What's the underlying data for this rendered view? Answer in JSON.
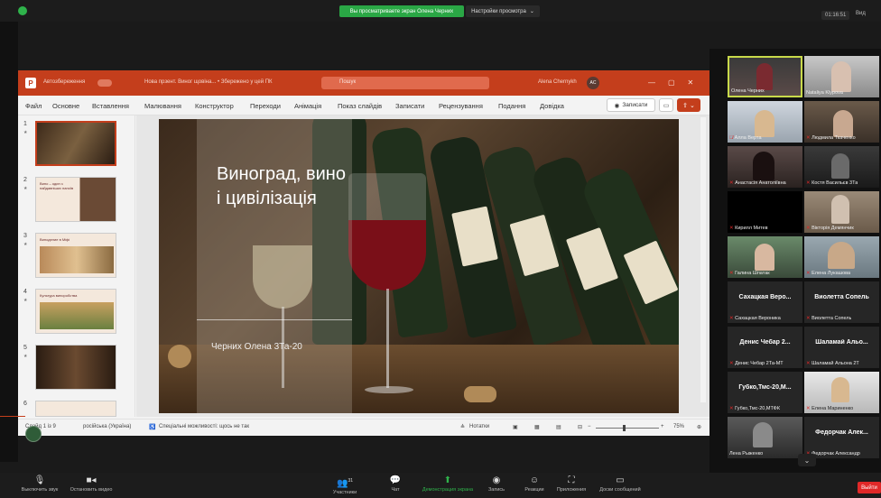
{
  "zoom_top": {
    "share_banner": "Вы просматриваете экран Олена Черних",
    "view_options": "Настройки просмотра",
    "timer": "01:16:51",
    "view": "Вид"
  },
  "ppt": {
    "autosave": "Автозбереження",
    "doc_title": "Нова прзент. Виног щовіна... • Збережено у цей ПК",
    "search_placeholder": "Пошук",
    "account_name": "Alena Chernykh",
    "account_initials": "AC",
    "tabs": [
      "Файл",
      "Основне",
      "Вставлення",
      "Малювання",
      "Конструктор",
      "Переходи",
      "Анімація",
      "Показ слайдів",
      "Записати",
      "Рецензування",
      "Подання",
      "Довідка"
    ],
    "record_label": "Записати",
    "slide_title": "Виноград, вино і цивілізація",
    "slide_author": "Черних Олена 3Та-20",
    "thumbs": [
      {
        "num": "1",
        "caption": ""
      },
      {
        "num": "2",
        "caption": "Вино – один з найдавніших напоїв"
      },
      {
        "num": "3",
        "caption": "Виноделие в Міфі"
      },
      {
        "num": "4",
        "caption": "Культура виноробства"
      },
      {
        "num": "5",
        "caption": ""
      },
      {
        "num": "6",
        "caption": ""
      }
    ],
    "status": {
      "slide_counter": "Слайд 1 із 9",
      "language": "російська (Україна)",
      "accessibility": "Спеціальні можливості: щось не так",
      "notes": "Нотатки",
      "zoom": "75%"
    }
  },
  "gallery": [
    {
      "name": "Олена Черних",
      "big": "",
      "video": true,
      "muted": false
    },
    {
      "name": "Nataliya Klypova",
      "big": "",
      "video": true,
      "muted": false
    },
    {
      "name": "Алла Верта",
      "big": "",
      "video": true,
      "muted": true
    },
    {
      "name": "Людмила Ткаченко",
      "big": "",
      "video": true,
      "muted": true
    },
    {
      "name": "Анастасія Анатоліївна",
      "big": "",
      "video": true,
      "muted": true
    },
    {
      "name": "Костя Васильєв 3Та",
      "big": "",
      "video": true,
      "muted": true
    },
    {
      "name": "Кирилл Митев",
      "big": "",
      "video": true,
      "muted": true
    },
    {
      "name": "Вікторія Демянчик",
      "big": "",
      "video": true,
      "muted": true
    },
    {
      "name": "Галина Шпатак",
      "big": "",
      "video": true,
      "muted": true
    },
    {
      "name": "Елена Лукашова",
      "big": "",
      "video": true,
      "muted": true
    },
    {
      "name": "Сахацкая Вероника",
      "big": "Сахацкая Веро...",
      "video": false,
      "muted": true
    },
    {
      "name": "Виолетта Сопель",
      "big": "Виолетта Сопель",
      "video": false,
      "muted": true
    },
    {
      "name": "Денис Чебар 2Та-МТ",
      "big": "Денис Чебар 2...",
      "video": false,
      "muted": true
    },
    {
      "name": "Шаламай Альона 2Т",
      "big": "Шаламай Альо...",
      "video": false,
      "muted": true
    },
    {
      "name": "Губко,Тмс-20,МТФК",
      "big": "Губко,Тмс-20,М...",
      "video": false,
      "muted": true
    },
    {
      "name": "Елена Мариненко",
      "big": "",
      "video": true,
      "muted": true
    },
    {
      "name": "Лена Рыженко",
      "big": "",
      "video": true,
      "muted": false
    },
    {
      "name": "Федорчак Александр",
      "big": "Федорчак Алек...",
      "video": false,
      "muted": true
    }
  ],
  "toolbar": {
    "mute": "Выключить звук",
    "video": "Остановить видео",
    "participants": "Участники",
    "participants_count": "31",
    "chat": "Чат",
    "share": "Демонстрация экрана",
    "record": "Запись",
    "reactions": "Реакции",
    "apps": "Приложения",
    "whiteboard": "Доски сообщений",
    "leave": "Выйти"
  }
}
